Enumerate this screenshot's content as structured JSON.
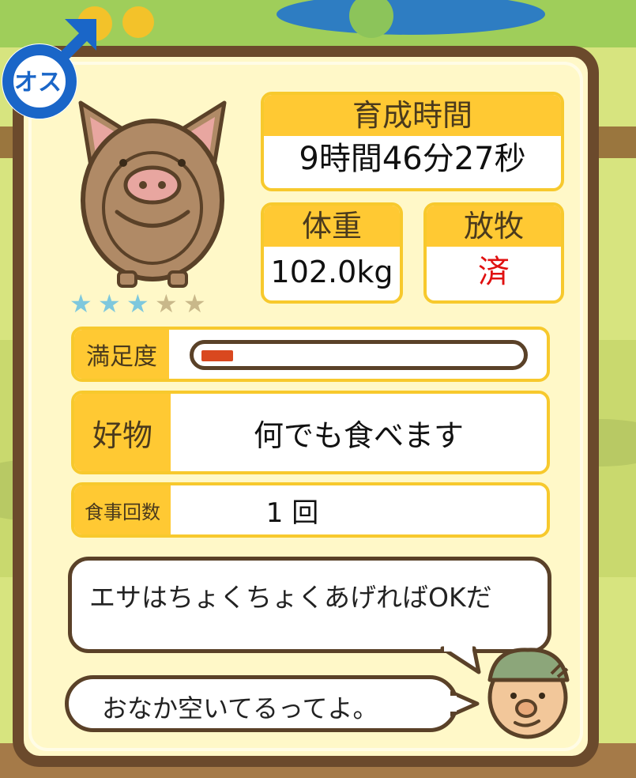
{
  "badge": {
    "text": "オス"
  },
  "rating": {
    "stars": 5,
    "filled": 3,
    "color_filled": "#7ec8dd",
    "color_empty": "#c9b88a"
  },
  "growth_time": {
    "label": "育成時間",
    "value": "9時間46分27秒"
  },
  "weight": {
    "label": "体重",
    "value": "102.0kg"
  },
  "grazing": {
    "label": "放牧",
    "value": "済",
    "value_color": "#e01010"
  },
  "satisfaction": {
    "label": "満足度",
    "level": 0.1,
    "bar_color": "#d9481f"
  },
  "favorite": {
    "label": "好物",
    "value": "何でも食べます"
  },
  "meals": {
    "label": "食事回数",
    "value": "1 回"
  },
  "dialog": {
    "farmer_line": "エサはちょくちょくあげればOKだ",
    "pig_line": "おなか空いてるってよ。"
  },
  "colors": {
    "frame": "#6b4a2c",
    "panel": "#fff8c8",
    "accent": "#ffc933",
    "badge_blue": "#1a66c8"
  }
}
